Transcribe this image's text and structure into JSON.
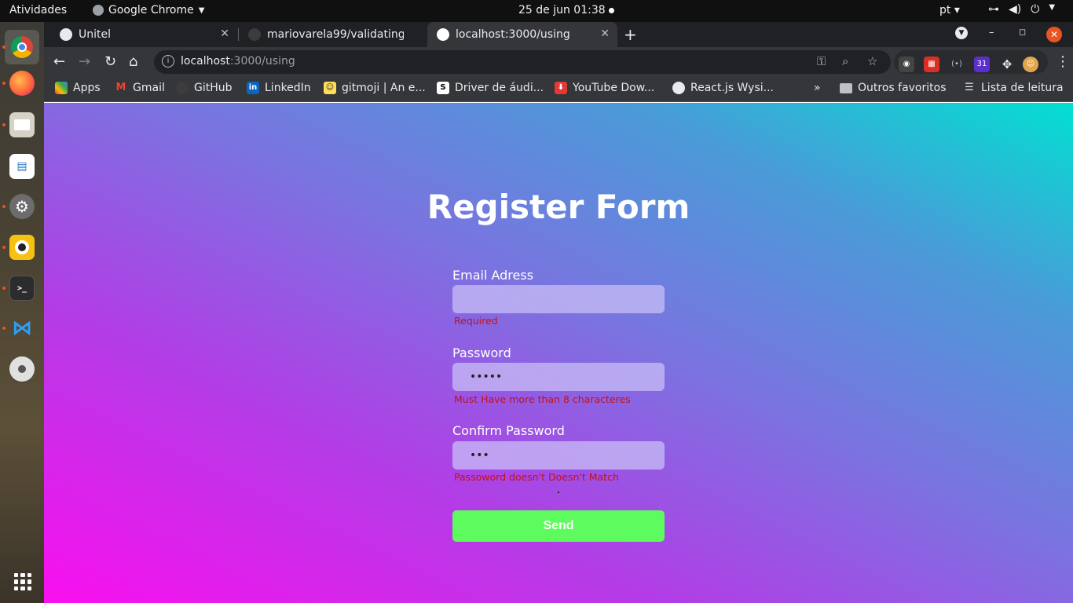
{
  "topbar": {
    "activities": "Atividades",
    "app_name": "Google Chrome",
    "clock": "25 de jun  01:38",
    "lang": "pt"
  },
  "tabs": [
    {
      "title": "Unitel",
      "active": false
    },
    {
      "title": "mariovarela99/validating",
      "active": false
    },
    {
      "title": "localhost:3000/using",
      "active": true
    }
  ],
  "toolbar": {
    "url_host": "localhost",
    "url_path": ":3000/using"
  },
  "bookmarks": {
    "items": [
      {
        "label": "Apps",
        "icon": "apps-grid-icon"
      },
      {
        "label": "Gmail",
        "icon": "gmail-icon"
      },
      {
        "label": "GitHub",
        "icon": "github-icon"
      },
      {
        "label": "LinkedIn",
        "icon": "linkedin-icon"
      },
      {
        "label": "gitmoji | An e...",
        "icon": "gitmoji-icon"
      },
      {
        "label": "Driver de áudi...",
        "icon": "s-icon"
      },
      {
        "label": "YouTube Dow...",
        "icon": "download-icon"
      },
      {
        "label": "React.js Wysi...",
        "icon": "globe-icon"
      }
    ],
    "other_folder": "Outros favoritos",
    "reading_list": "Lista de leitura",
    "overflow": "»"
  },
  "form": {
    "title": "Register Form",
    "email_label": "Email Adress",
    "email_value": "",
    "email_error": "Required",
    "password_label": "Password",
    "password_value": "•••••",
    "password_error": "Must Have more than 8 characteres",
    "confirm_label": "Confirm Password",
    "confirm_value": "•••",
    "confirm_error": "Passoword doesn't Doesn't Match",
    "send_label": "Send"
  },
  "colors": {
    "gradient_start": "#fa0fef",
    "gradient_end": "#02dfd2",
    "error": "#c0121e",
    "send_button": "#5dfb5d"
  }
}
